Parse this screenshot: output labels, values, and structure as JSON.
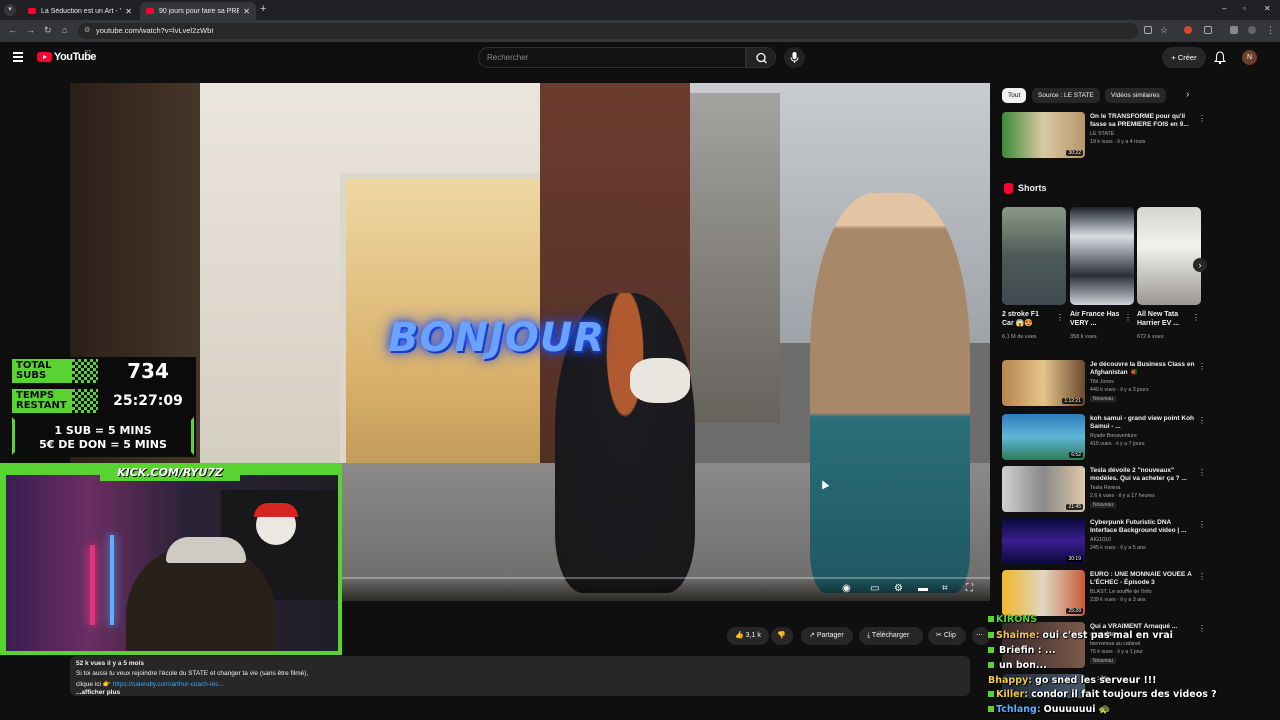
{
  "browser": {
    "tabs": [
      {
        "title": "La Séduction est un Art - YouTube"
      },
      {
        "title": "90 jours pour faire sa PREMIERE..."
      }
    ],
    "url": "youtube.com/watch?v=lvLvel2zWbI"
  },
  "youtube": {
    "logo_text": "YouTube",
    "country_code": "PT",
    "search_placeholder": "Rechercher",
    "create_label": "Créer",
    "avatar_letter": "N"
  },
  "video": {
    "overlay_text": "BONJOUR",
    "actions": {
      "likes": "3,1 k",
      "share": "Partager",
      "download": "Télécharger",
      "clip": "Clip"
    },
    "description": {
      "stats": "52 k vues  il y a 5 mois",
      "line1": "Si toi aussi tu veux rejoindre l'école du STATE et changer ta vie (sans être filmé),",
      "line2_prefix": "clique ici 👉",
      "link": "https://calendly.com/arthur-coach-les...",
      "more": "...afficher plus"
    }
  },
  "sidebar": {
    "chips": [
      "Tout",
      "Source : LE STATE",
      "Vidéos similaires"
    ],
    "top_video": {
      "title": "On le TRANSFORME pour qu'il fasse sa PREMIERE FOIS en 9...",
      "channel": "LE STATE",
      "meta": "19 k vues · il y a 4 mois",
      "duration": "30:22"
    },
    "shorts_label": "Shorts",
    "shorts": [
      {
        "title": "2 stroke F1 Car 😱😍",
        "views": "6,1 M de vues"
      },
      {
        "title": "Air France Has VERY ...",
        "views": "358 k vues"
      },
      {
        "title": "All New Tata Harrier EV ...",
        "views": "672 k vues"
      }
    ],
    "videos": [
      {
        "title": "Je découvre la Business Class en Afghanistan 🇦🇫",
        "channel": "Tibi Jones",
        "meta": "440 k vues · il y a 3 jours",
        "badge": "Nouveau",
        "duration": "1:12:21"
      },
      {
        "title": "koh samui - grand view point Koh Samui - ...",
        "channel": "Ryade Bonaventure",
        "meta": "415 vues · il y a 7 jours",
        "badge": "",
        "duration": "6:52"
      },
      {
        "title": "Tesla dévoile 2 \"nouveaux\" modèles. Qui va acheter ça ? ...",
        "channel": "Tesla Riviera",
        "meta": "2,6 k vues · il y a 17 heures",
        "badge": "Nouveau",
        "duration": "21:45"
      },
      {
        "title": "Cyberpunk Futuristic DNA Interface Background video | ...",
        "channel": "AIG1010",
        "meta": "245 k vues · il y a 5 ans",
        "badge": "",
        "duration": "30:19"
      },
      {
        "title": "EURO : UNE MONNAIE VOUÉE À L'ÉCHEC - Épisode 3",
        "channel": "BLAST, Le souffle de l'info",
        "meta": "239 k vues · il y a 3 ans",
        "badge": "",
        "duration": "25:28"
      },
      {
        "title": "Qui a VRAIMENT Arnaqué ... enquête",
        "channel": "bienvenue au cabinet",
        "meta": "76 k vues · il y a 1 jour",
        "badge": "Nouveau",
        "duration": ""
      },
      {
        "title": "... : je",
        "channel": "",
        "meta": "",
        "badge": "",
        "duration": ""
      }
    ]
  },
  "stream": {
    "total_subs_label_1": "TOTAL",
    "total_subs_label_2": "SUBS",
    "total_subs": "734",
    "time_label_1": "TEMPS",
    "time_label_2": "RESTANT",
    "time_remaining": "25:27:09",
    "rule_1": "1 SUB = 5 MINS",
    "rule_2": "5€ DE DON = 5 MINS",
    "kick_url": "KICK.COM/RYU7Z",
    "chat": [
      {
        "user": "KIRONS",
        "message": ""
      },
      {
        "user": "Shaime:",
        "message": "oui c'est pas mal en vrai"
      },
      {
        "user": "",
        "message": "Briefin : ..."
      },
      {
        "user": "",
        "message": "un bon..."
      },
      {
        "user": "Bhappy:",
        "message": "go sned les serveur !!!"
      },
      {
        "user": "Killer:",
        "message": "condor il fait toujours des videos ?"
      },
      {
        "user": "Tchlang:",
        "message": "Ouuuuuui 🐢"
      }
    ]
  }
}
